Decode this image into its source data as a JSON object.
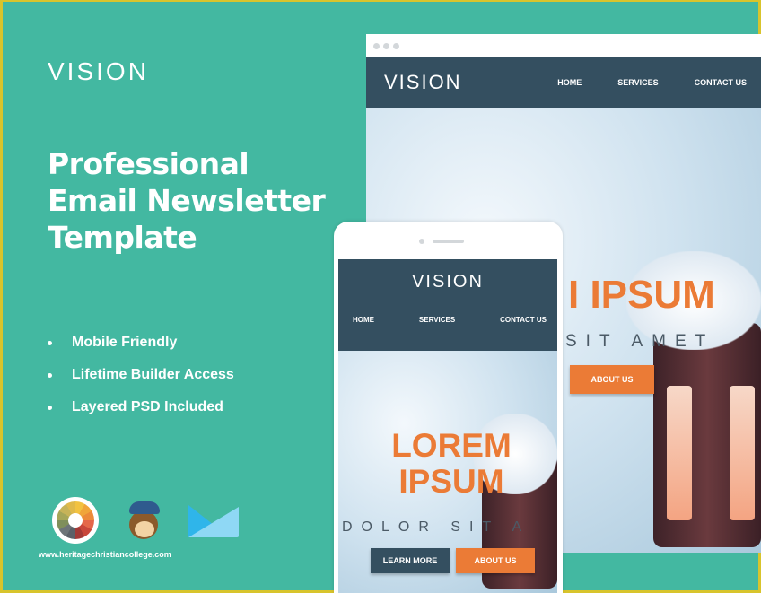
{
  "promo": {
    "brand": "VISION",
    "headline": [
      "Professional",
      "Email Newsletter",
      "Template"
    ],
    "features": [
      "Mobile Friendly",
      "Lifetime Builder Access",
      "Layered PSD Included"
    ],
    "logos": [
      "color-wheel-icon",
      "mailchimp-icon",
      "campaign-monitor-icon"
    ],
    "watermark": "www.heritagechristiancollege.com"
  },
  "desktop": {
    "logo": "VISION",
    "nav": [
      "HOME",
      "SERVICES",
      "CONTACT US"
    ],
    "hero_title": "LOREM IPSUM",
    "hero_title_visible": "I IPSUM",
    "hero_sub": "SIT AMET",
    "cta": "ABOUT US"
  },
  "mobile": {
    "logo": "VISION",
    "nav": [
      "HOME",
      "SERVICES",
      "CONTACT US"
    ],
    "hero_title": [
      "LOREM",
      "IPSUM"
    ],
    "hero_sub": "DOLOR SIT A",
    "buttons": [
      "LEARN MORE",
      "ABOUT US"
    ]
  },
  "colors": {
    "background": "#43b8a1",
    "border": "#d8c42c",
    "nav": "#344f60",
    "accent": "#eb7b36"
  }
}
